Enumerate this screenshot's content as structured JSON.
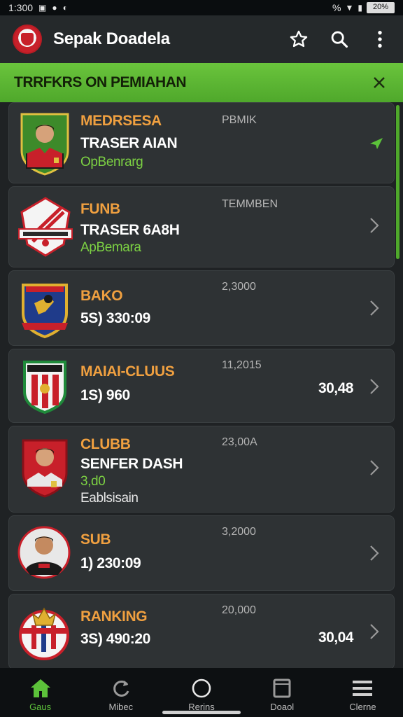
{
  "status_bar": {
    "time": "1:300",
    "battery": "20%",
    "signal_text": "%"
  },
  "app_bar": {
    "title": "Sepak Doadela",
    "actions": [
      "star-icon",
      "search-icon",
      "more-vert-icon"
    ]
  },
  "banner": {
    "text": "TRRFKRS ON PEMIAHAN",
    "close_icon": "close-icon"
  },
  "cards": [
    {
      "name": "MEDRSESA",
      "line2": "TRASER AIAN",
      "line3": "OpBenrarg",
      "line4": "",
      "meta": "PBMIK",
      "value": "",
      "trailing": "check",
      "crest": "player"
    },
    {
      "name": "FUNB",
      "line2": "TRASER 6A8H",
      "line3": "ApBemara",
      "line4": "",
      "meta": "TEMMBEN",
      "value": "",
      "trailing": "chevron",
      "crest": "shield-white"
    },
    {
      "name": "BAKO",
      "line2": "5S) 330:09",
      "line3": "",
      "line4": "",
      "meta": "2,3000",
      "value": "",
      "trailing": "chevron",
      "crest": "shield-blue"
    },
    {
      "name": "MAIAI-CLUUS",
      "line2": "1S) 960",
      "line3": "",
      "line4": "",
      "meta": "11,2015",
      "value": "30,48",
      "trailing": "chevron",
      "crest": "shield-stripes"
    },
    {
      "name": "CLUBB",
      "line2": "SENFER DASH",
      "line3": "3,d0",
      "line4": "Eablsisain",
      "meta": "23,00A",
      "value": "",
      "trailing": "chevron",
      "crest": "player-red"
    },
    {
      "name": "SUB",
      "line2": "1) 230:09",
      "line3": "",
      "line4": "",
      "meta": "3,2000",
      "value": "",
      "trailing": "chevron",
      "crest": "player-round"
    },
    {
      "name": "RANKING",
      "line2": "3S) 490:20",
      "line3": "",
      "line4": "",
      "meta": "20,000",
      "value": "30,04",
      "trailing": "chevron",
      "crest": "crest-round"
    }
  ],
  "bottom_nav": [
    {
      "label": "Gaus",
      "icon": "home-icon",
      "active": true
    },
    {
      "label": "Mibec",
      "icon": "refresh-icon",
      "active": false
    },
    {
      "label": "Rerins",
      "icon": "circle-icon",
      "active": false
    },
    {
      "label": "Doaol",
      "icon": "tablet-icon",
      "active": false
    },
    {
      "label": "Clerne",
      "icon": "menu-icon",
      "active": false
    }
  ],
  "colors": {
    "accent_green": "#5cc23a",
    "banner_green": "#6ac43c",
    "name_orange": "#f0a040",
    "card_bg": "#2e3234"
  }
}
